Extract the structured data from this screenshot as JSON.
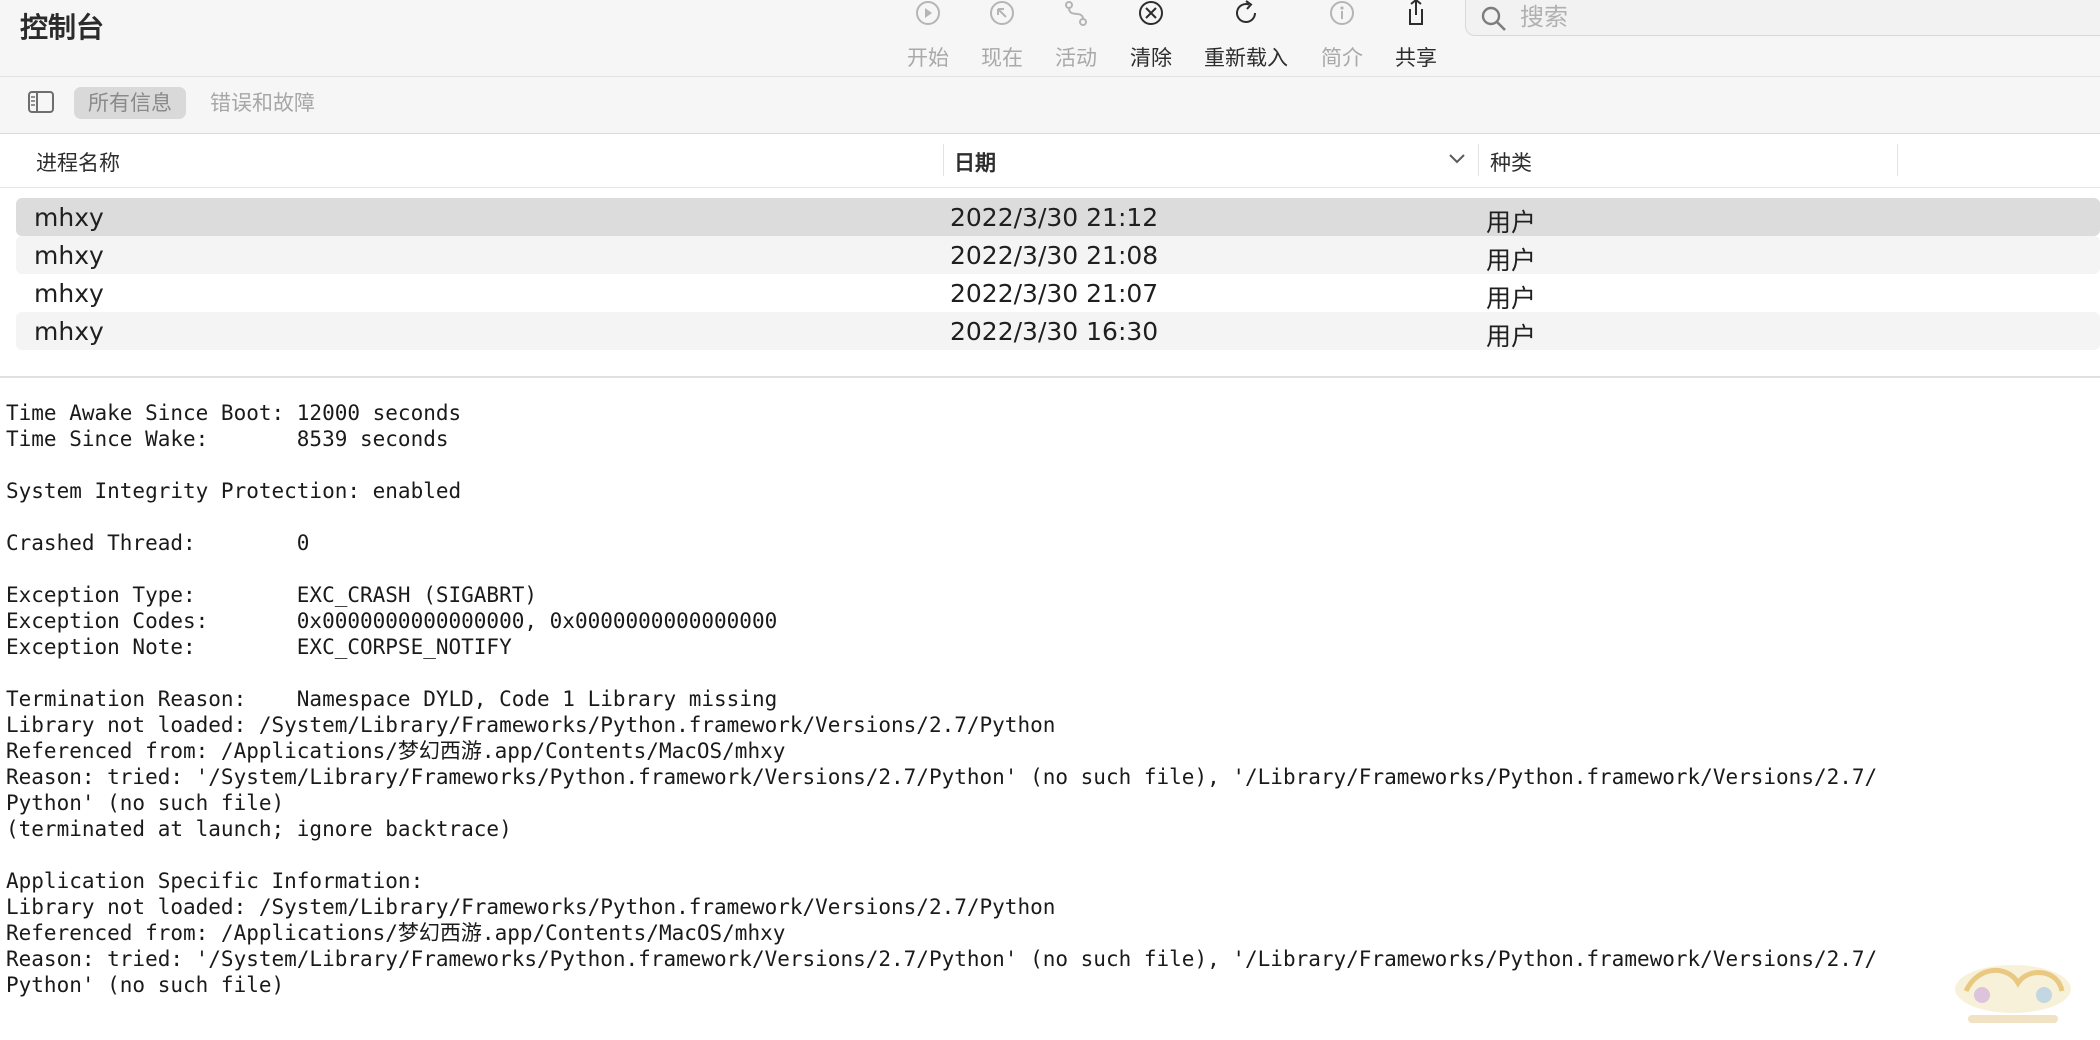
{
  "app": {
    "title": "控制台"
  },
  "toolbar": {
    "start": "开始",
    "now": "现在",
    "activity": "活动",
    "clear": "清除",
    "reload": "重新载入",
    "info": "简介",
    "share": "共享"
  },
  "search": {
    "placeholder": "搜索"
  },
  "filters": {
    "all": "所有信息",
    "errors": "错误和故障"
  },
  "columns": {
    "process": "进程名称",
    "date": "日期",
    "type": "种类"
  },
  "rows": [
    {
      "process": "mhxy",
      "date": "2022/3/30 21:12",
      "type": "用户"
    },
    {
      "process": "mhxy",
      "date": "2022/3/30 21:08",
      "type": "用户"
    },
    {
      "process": "mhxy",
      "date": "2022/3/30 21:07",
      "type": "用户"
    },
    {
      "process": "mhxy",
      "date": "2022/3/30 16:30",
      "type": "用户"
    }
  ],
  "report": {
    "text": "Time Awake Since Boot: 12000 seconds\nTime Since Wake:       8539 seconds\n\nSystem Integrity Protection: enabled\n\nCrashed Thread:        0\n\nException Type:        EXC_CRASH (SIGABRT)\nException Codes:       0x0000000000000000, 0x0000000000000000\nException Note:        EXC_CORPSE_NOTIFY\n\nTermination Reason:    Namespace DYLD, Code 1 Library missing\nLibrary not loaded: /System/Library/Frameworks/Python.framework/Versions/2.7/Python\nReferenced from: /Applications/梦幻西游.app/Contents/MacOS/mhxy\nReason: tried: '/System/Library/Frameworks/Python.framework/Versions/2.7/Python' (no such file), '/Library/Frameworks/Python.framework/Versions/2.7/\nPython' (no such file)\n(terminated at launch; ignore backtrace)\n\nApplication Specific Information:\nLibrary not loaded: /System/Library/Frameworks/Python.framework/Versions/2.7/Python\nReferenced from: /Applications/梦幻西游.app/Contents/MacOS/mhxy\nReason: tried: '/System/Library/Frameworks/Python.framework/Versions/2.7/Python' (no such file), '/Library/Frameworks/Python.framework/Versions/2.7/\nPython' (no such file)"
  },
  "icons": {
    "start": "play-icon",
    "now": "arrow-up-left-icon",
    "activity": "activity-icon",
    "clear": "clear-x-icon",
    "reload": "reload-icon",
    "info": "info-icon",
    "share": "share-icon",
    "search": "search-icon",
    "sidebar": "sidebar-toggle-icon"
  },
  "colors": {
    "selected_row": "#dcdcdc",
    "alt_row": "#f4f4f5",
    "disabled_label": "#a9a9a9"
  }
}
